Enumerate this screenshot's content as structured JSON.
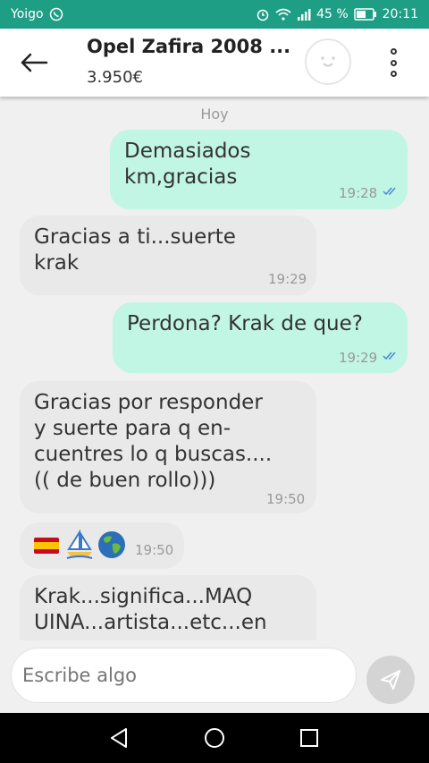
{
  "statusbar": {
    "carrier": "Yoigo",
    "battery": "45 %",
    "time": "20:11"
  },
  "header": {
    "title": "Opel Zafira 2008 ...",
    "price": "3.950€"
  },
  "chat": {
    "date": "Hoy",
    "messages": [
      {
        "direction": "out",
        "lines": [
          "Demasiados",
          "km,gracias"
        ],
        "time": "19:28",
        "read": true
      },
      {
        "direction": "in",
        "lines": [
          "Gracias a ti...suerte",
          "krak"
        ],
        "time": "19:29"
      },
      {
        "direction": "out",
        "lines": [
          "Perdona? Krak de que?"
        ],
        "time": "19:29",
        "read": true
      },
      {
        "direction": "in",
        "lines": [
          "Gracias por responder",
          "y suerte para q en-",
          "cuentres lo q buscas....",
          "(( de buen rollo)))"
        ],
        "time": "19:50"
      },
      {
        "direction": "in",
        "emojis": [
          "spain-flag-icon",
          "sailboat-icon",
          "globe-icon"
        ],
        "time": "19:50"
      },
      {
        "direction": "in",
        "lines": [
          "Krak...significa...MAQ",
          "UINA...artista...etc...en"
        ]
      }
    ]
  },
  "composer": {
    "placeholder": "Escribe algo"
  },
  "colors": {
    "statusbar": "#1f9e86",
    "outgoing": "#c1f5e4",
    "incoming": "#e9e9e9",
    "ticks": "#4d86d6"
  }
}
